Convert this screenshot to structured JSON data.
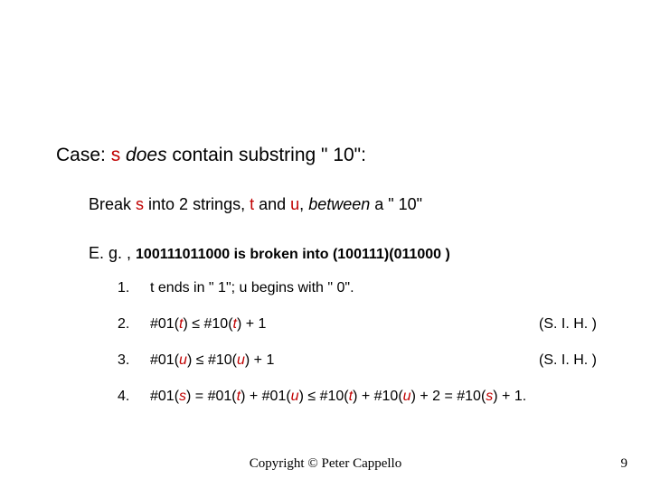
{
  "case": {
    "prefix": "Case: ",
    "s": "s",
    "middle": " ",
    "does": "does",
    "rest": " contain substring \" 10\":"
  },
  "break": {
    "prefix": "Break ",
    "s": "s",
    "mid1": " into 2 strings, ",
    "t": "t",
    "and": " and ",
    "u": "u",
    "comma": ", ",
    "between": "between",
    "rest": " a \" 10\""
  },
  "eg": {
    "prefix": "E. g. , ",
    "bold": "100111011000 is broken into (100111)(011000 )"
  },
  "items": {
    "i1": {
      "num": "1.",
      "text": " t ends in \" 1\"; u begins with \" 0\"."
    },
    "i2": {
      "num": "2.",
      "p1": "#01(",
      "t1": "t",
      "p2": ")  ",
      "le": "≤",
      "p3": " #10(",
      "t2": "t",
      "p4": ") + 1",
      "sih": "(S. I. H. )"
    },
    "i3": {
      "num": "3.",
      "p1": "#01(",
      "u1": "u",
      "p2": ") ",
      "le": "≤",
      "p3": " #10(",
      "u2": "u",
      "p4": ") + 1",
      "sih": "(S. I. H. )"
    },
    "i4": {
      "num": "4.",
      "p1": "#01(",
      "s1": "s",
      "p2": ") = #01(",
      "t1": "t",
      "p3": ") + #01(",
      "u1": "u",
      "p4": ") ",
      "le": "≤",
      "p5": " #10(",
      "t2": "t",
      "p6": ") + #10(",
      "u2": "u",
      "p7": ") + 2 = #10(",
      "s2": "s",
      "p8": ") + 1."
    }
  },
  "footer": "Copyright © Peter Cappello",
  "pagenum": "9"
}
